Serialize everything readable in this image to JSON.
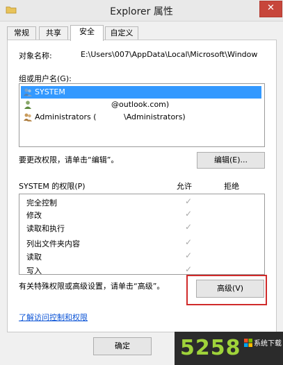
{
  "window": {
    "title": "Explorer 属性",
    "close_glyph": "✕"
  },
  "tabs": [
    {
      "label": "常规"
    },
    {
      "label": "共享"
    },
    {
      "label": "安全"
    },
    {
      "label": "自定义"
    }
  ],
  "security": {
    "object_name_label": "对象名称:",
    "object_name_value": "E:\\Users\\007\\AppData\\Local\\Microsoft\\Window",
    "groups_label": "组或用户名(G):",
    "users": [
      {
        "name": "SYSTEM",
        "icon": "group-icon"
      },
      {
        "name": "@outlook.com)",
        "icon": "user-icon"
      },
      {
        "name": "Administrators (",
        "name_suffix": "\\Administrators)",
        "icon": "group-icon"
      }
    ],
    "edit_hint": "要更改权限，请单击“编辑”。",
    "edit_button": "编辑(E)...",
    "permissions_label": "SYSTEM 的权限(P)",
    "allow_header": "允许",
    "deny_header": "拒绝",
    "permissions": [
      {
        "name": "完全控制",
        "allow": "✓"
      },
      {
        "name": "修改",
        "allow": "✓"
      },
      {
        "name": "读取和执行",
        "allow": "✓"
      },
      {
        "name": "列出文件夹内容",
        "allow": "✓"
      },
      {
        "name": "读取",
        "allow": "✓"
      },
      {
        "name": "写入",
        "allow": "✓"
      }
    ],
    "advanced_hint": "有关特殊权限或高级设置，请单击“高级”。",
    "advanced_button": "高级(V)",
    "learn_link": "了解访问控制和权限"
  },
  "footer": {
    "ok_button": "确定"
  },
  "watermark": {
    "number": "5258",
    "text": "系统下载"
  },
  "colors": {
    "selection": "#3399ff",
    "highlight": "#d02a2a",
    "link": "#0a53d6",
    "watermark_green": "#9fd33a"
  }
}
